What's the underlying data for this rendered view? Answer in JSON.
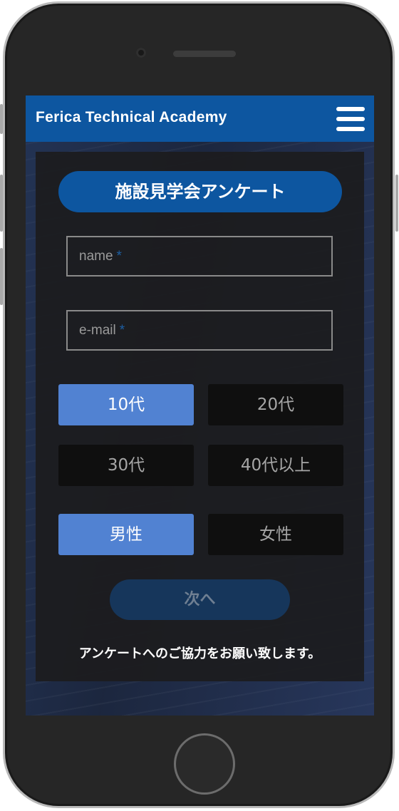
{
  "header": {
    "brand": "Ferica Technical Academy"
  },
  "survey": {
    "title": "施設見学会アンケート",
    "name_placeholder": "name",
    "email_placeholder": "e-mail",
    "required_mark": "*",
    "age_options": [
      {
        "label": "10代",
        "selected": true
      },
      {
        "label": "20代",
        "selected": false
      },
      {
        "label": "30代",
        "selected": false
      },
      {
        "label": "40代以上",
        "selected": false
      }
    ],
    "gender_options": [
      {
        "label": "男性",
        "selected": true
      },
      {
        "label": "女性",
        "selected": false
      }
    ],
    "next_button": "次へ",
    "footer_note": "アンケートへのご協力をお願い致します。"
  },
  "colors": {
    "header_blue": "#0d56a0",
    "selected_option": "#5182d2",
    "unselected_option": "#0f0f0f",
    "next_button_bg": "#16365b"
  }
}
